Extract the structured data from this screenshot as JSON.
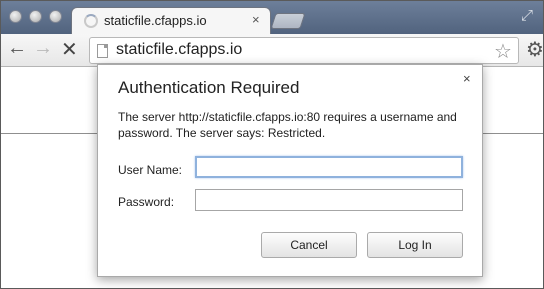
{
  "browser": {
    "tab_title": "staticfile.cfapps.io",
    "tab_close": "×",
    "url": "staticfile.cfapps.io",
    "icons": [
      "back-icon",
      "forward-icon",
      "stop-icon",
      "page-icon",
      "star-icon",
      "wrench-icon",
      "fullscreen-icon"
    ]
  },
  "dialog": {
    "title": "Authentication Required",
    "close": "×",
    "message": "The server http://staticfile.cfapps.io:80 requires a username and password. The server says: Restricted.",
    "username_label": "User Name:",
    "username_value": "",
    "password_label": "Password:",
    "password_value": "",
    "cancel_label": "Cancel",
    "login_label": "Log In"
  }
}
